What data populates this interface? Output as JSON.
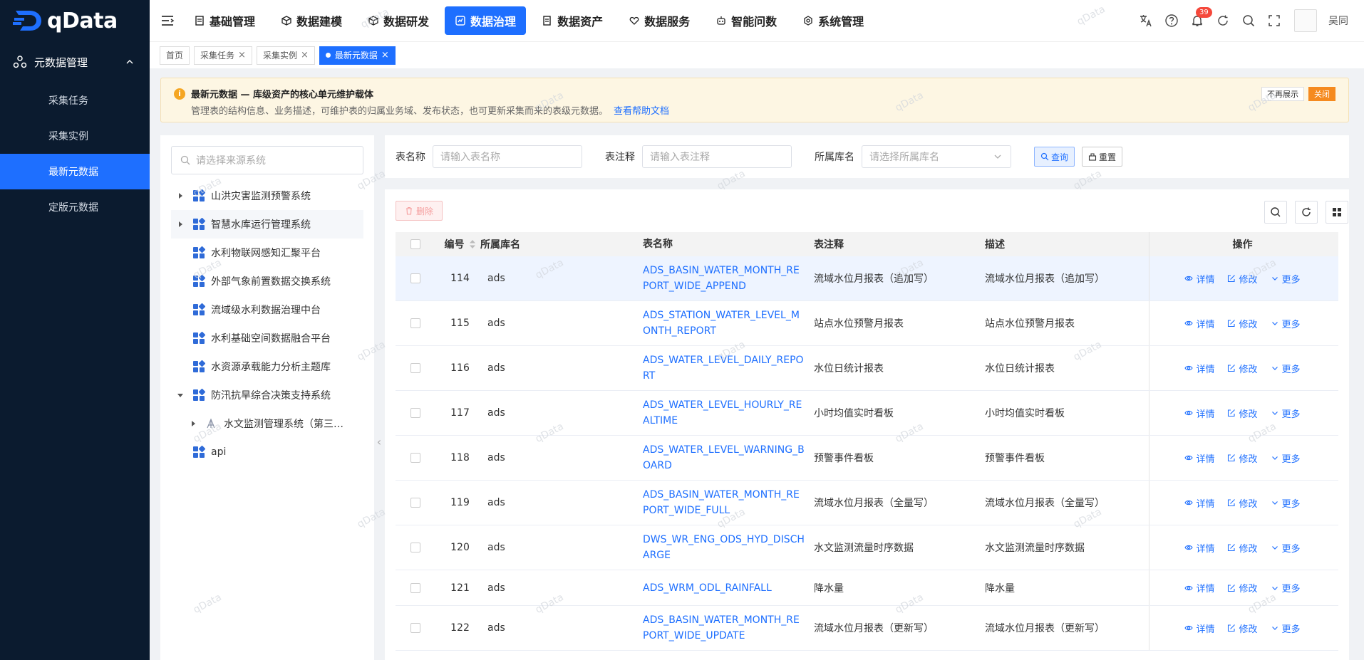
{
  "app": {
    "logo_text": "qData"
  },
  "sidebar": {
    "group_label": "元数据管理",
    "items": [
      {
        "label": "采集任务",
        "active": false
      },
      {
        "label": "采集实例",
        "active": false
      },
      {
        "label": "最新元数据",
        "active": true
      },
      {
        "label": "定版元数据",
        "active": false
      }
    ]
  },
  "topnav": {
    "items": [
      {
        "label": "基础管理",
        "active": false
      },
      {
        "label": "数据建模",
        "active": false
      },
      {
        "label": "数据研发",
        "active": false
      },
      {
        "label": "数据治理",
        "active": true
      },
      {
        "label": "数据资产",
        "active": false
      },
      {
        "label": "数据服务",
        "active": false
      },
      {
        "label": "智能问数",
        "active": false
      },
      {
        "label": "系统管理",
        "active": false
      }
    ],
    "notification_count": "39",
    "username": "吴同"
  },
  "tabs": [
    {
      "label": "首页",
      "closable": false,
      "active": false
    },
    {
      "label": "采集任务",
      "closable": true,
      "active": false
    },
    {
      "label": "采集实例",
      "closable": true,
      "active": false
    },
    {
      "label": "最新元数据",
      "closable": true,
      "active": true
    }
  ],
  "notice": {
    "title": "最新元数据 — 库级资产的核心单元维护载体",
    "desc": "管理表的结构信息、业务描述，可维护表的归属业务域、发布状态，也可更新采集而来的表级元数据。",
    "help_link": "查看帮助文档",
    "dont_show": "不再展示",
    "close": "关闭"
  },
  "source_tree": {
    "search_placeholder": "请选择来源系统",
    "nodes": [
      {
        "label": "山洪灾害监测预警系统",
        "arrow": "right",
        "indent": 0,
        "icon": "db-grid-icon"
      },
      {
        "label": "智慧水库运行管理系统",
        "arrow": "right",
        "indent": 0,
        "icon": "db-grid-icon",
        "highlight": true
      },
      {
        "label": "水利物联网感知汇聚平台",
        "arrow": "none",
        "indent": 0,
        "icon": "db-grid-icon"
      },
      {
        "label": "外部气象前置数据交换系统",
        "arrow": "none",
        "indent": 0,
        "icon": "db-grid-icon"
      },
      {
        "label": "流域级水利数据治理中台",
        "arrow": "none",
        "indent": 0,
        "icon": "db-grid-icon"
      },
      {
        "label": "水利基础空间数据融合平台",
        "arrow": "none",
        "indent": 0,
        "icon": "db-grid-icon"
      },
      {
        "label": "水资源承载能力分析主题库",
        "arrow": "none",
        "indent": 0,
        "icon": "db-grid-icon"
      },
      {
        "label": "防汛抗旱综合决策支持系统",
        "arrow": "down",
        "indent": 0,
        "icon": "db-grid-icon"
      },
      {
        "label": "水文监测管理系统（第三…",
        "arrow": "right",
        "indent": 1,
        "icon": "tree-branch-icon"
      },
      {
        "label": "api",
        "arrow": "none",
        "indent": 0,
        "icon": "db-grid-icon"
      }
    ]
  },
  "filters": {
    "table_name_label": "表名称",
    "table_name_placeholder": "请输入表名称",
    "table_comment_label": "表注释",
    "table_comment_placeholder": "请输入表注释",
    "db_label": "所属库名",
    "db_placeholder": "请选择所属库名",
    "query_btn": "查询",
    "reset_btn": "重置"
  },
  "toolbar": {
    "delete_btn": "删除"
  },
  "table": {
    "headers": {
      "id": "编号",
      "db": "所属库名",
      "name": "表名称",
      "comment": "表注释",
      "desc": "描述",
      "ops": "操作"
    },
    "op_labels": {
      "detail": "详情",
      "edit": "修改",
      "more": "更多"
    },
    "rows": [
      {
        "id": "114",
        "db": "ads",
        "name": "ADS_BASIN_WATER_MONTH_REPORT_WIDE_APPEND",
        "comment": "流域水位月报表（追加写）",
        "desc": "流域水位月报表（追加写）"
      },
      {
        "id": "115",
        "db": "ads",
        "name": "ADS_STATION_WATER_LEVEL_MONTH_REPORT",
        "comment": "站点水位预警月报表",
        "desc": "站点水位预警月报表"
      },
      {
        "id": "116",
        "db": "ads",
        "name": "ADS_WATER_LEVEL_DAILY_REPORT",
        "comment": "水位日统计报表",
        "desc": "水位日统计报表"
      },
      {
        "id": "117",
        "db": "ads",
        "name": "ADS_WATER_LEVEL_HOURLY_REALTIME",
        "comment": "小时均值实时看板",
        "desc": "小时均值实时看板"
      },
      {
        "id": "118",
        "db": "ads",
        "name": "ADS_WATER_LEVEL_WARNING_BOARD",
        "comment": "预警事件看板",
        "desc": "预警事件看板"
      },
      {
        "id": "119",
        "db": "ads",
        "name": "ADS_BASIN_WATER_MONTH_REPORT_WIDE_FULL",
        "comment": "流域水位月报表（全量写）",
        "desc": "流域水位月报表（全量写）"
      },
      {
        "id": "120",
        "db": "ads",
        "name": "DWS_WR_ENG_ODS_HYD_DISCHARGE",
        "comment": "水文监测流量时序数据",
        "desc": "水文监测流量时序数据"
      },
      {
        "id": "121",
        "db": "ads",
        "name": "ADS_WRM_ODL_RAINFALL",
        "comment": "降水量",
        "desc": "降水量"
      },
      {
        "id": "122",
        "db": "ads",
        "name": "ADS_BASIN_WATER_MONTH_REPORT_WIDE_UPDATE",
        "comment": "流域水位月报表（更新写）",
        "desc": "流域水位月报表（更新写）"
      }
    ]
  },
  "watermark": "qData",
  "colors": {
    "primary": "#1e6fff",
    "sidebar_bg": "#0b1b2f",
    "notice_bg": "#fdf6e3",
    "close_btn": "#f58a1f",
    "badge": "#f5483b"
  }
}
